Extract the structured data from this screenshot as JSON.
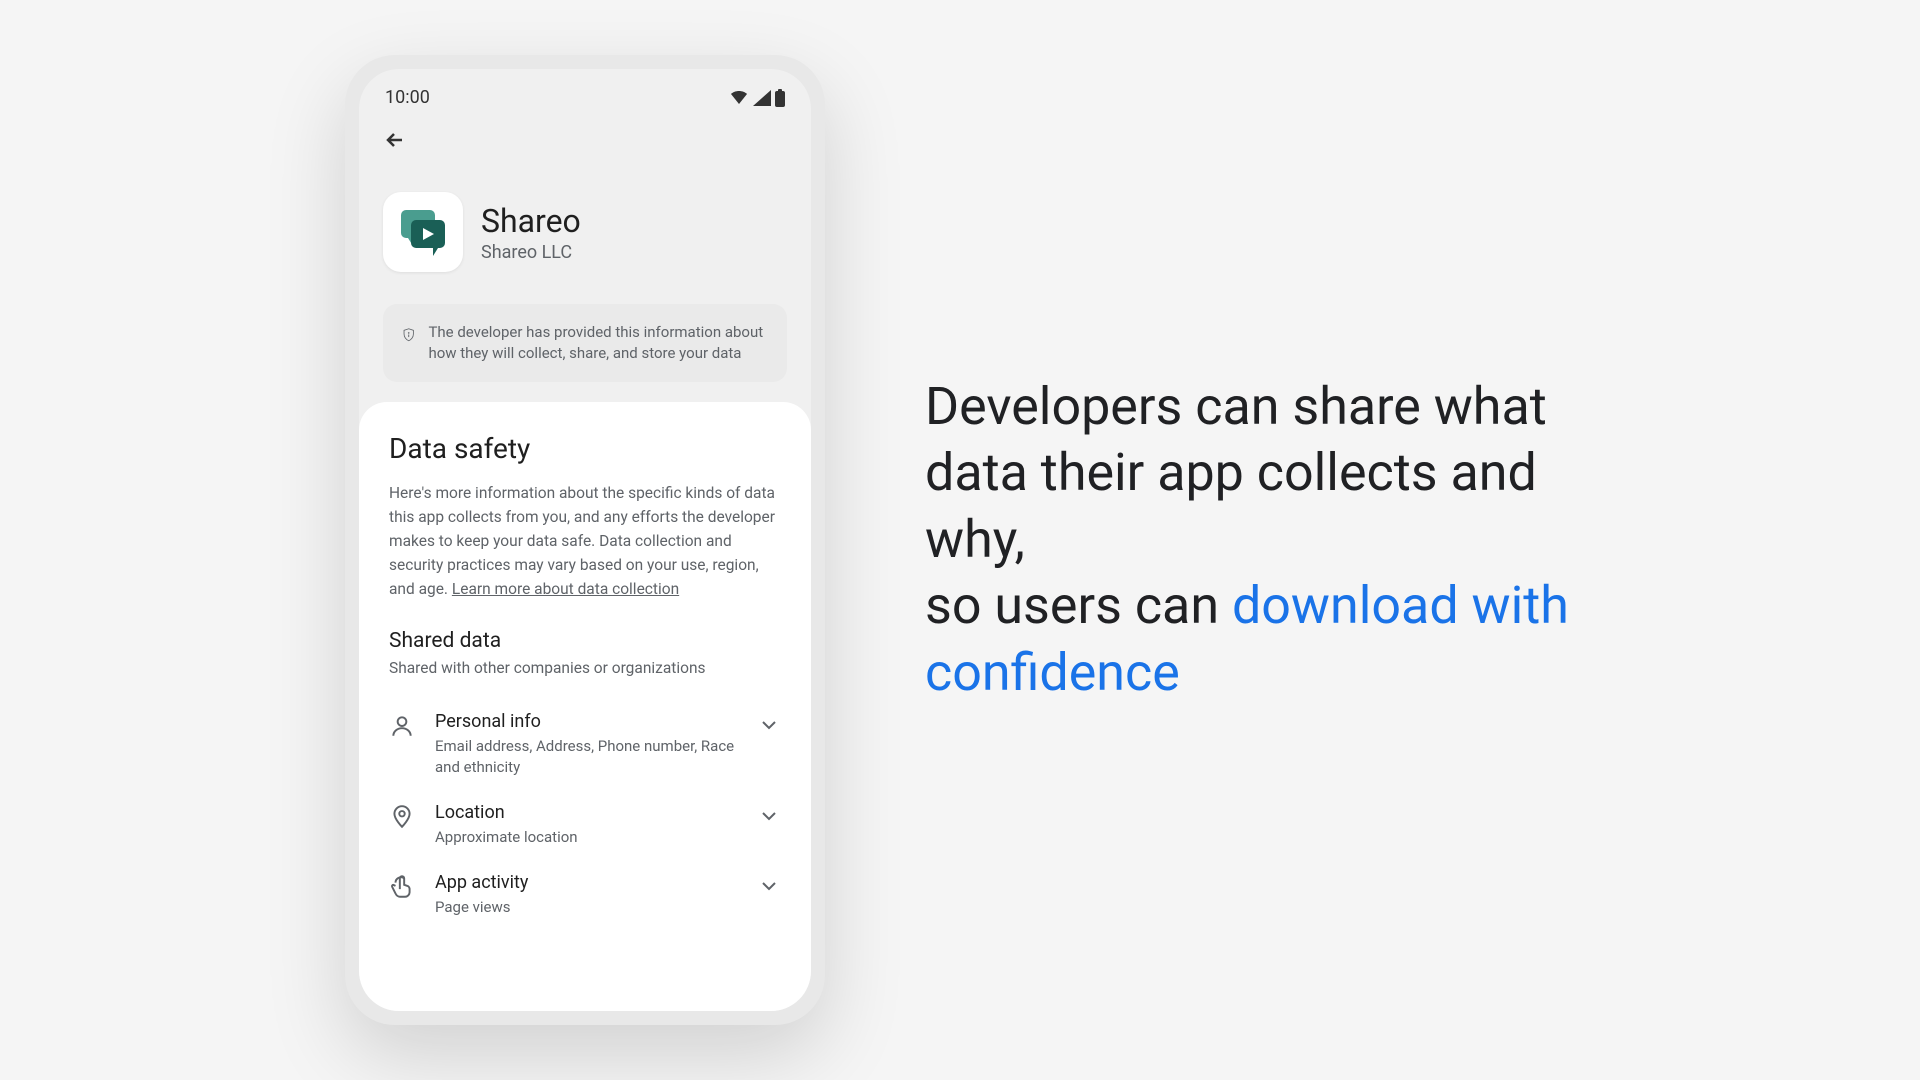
{
  "status_bar": {
    "time": "10:00"
  },
  "app": {
    "name": "Shareo",
    "publisher": "Shareo LLC"
  },
  "info_box": {
    "text": "The developer has provided this information about how they will collect, share, and store your data"
  },
  "data_safety": {
    "title": "Data safety",
    "description": "Here's more information about the specific kinds of data this app collects from you, and any efforts the developer makes to keep your data safe. Data collection and security practices may vary based on your use, region, and age. ",
    "learn_more": "Learn more about data collection"
  },
  "shared_data": {
    "title": "Shared data",
    "subtitle": "Shared with other companies or organizations",
    "items": [
      {
        "title": "Personal info",
        "desc": "Email address, Address, Phone number, Race and ethnicity"
      },
      {
        "title": "Location",
        "desc": "Approximate location"
      },
      {
        "title": "App activity",
        "desc": "Page views"
      }
    ]
  },
  "marketing": {
    "line1": "Developers can share what data their app collects and why,",
    "line2_prefix": "so users can ",
    "line2_highlight": "download with confidence"
  }
}
